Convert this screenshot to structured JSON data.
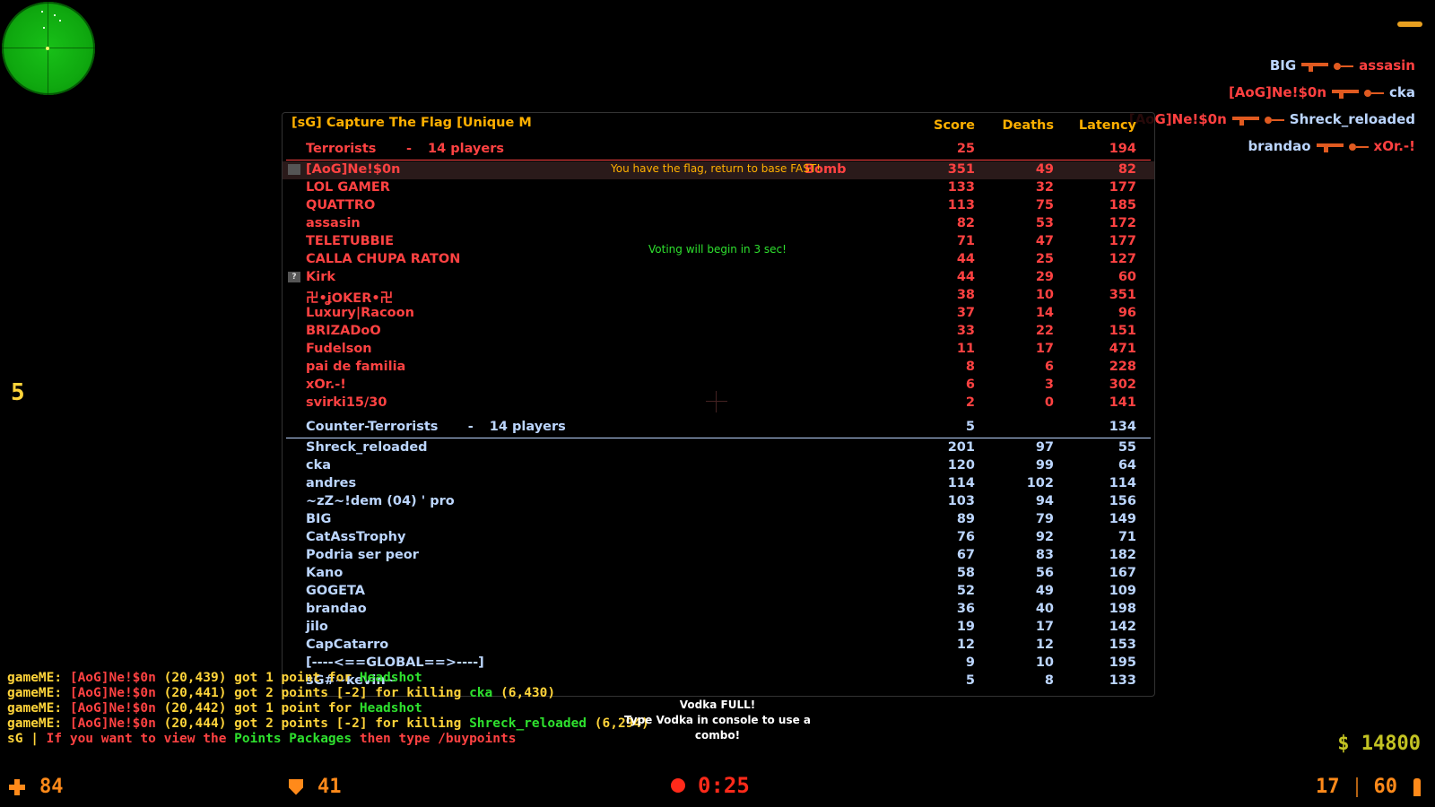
{
  "killfeed": [
    {
      "killer": "BIG",
      "killer_team": "ct",
      "victim": "assasin",
      "victim_team": "t"
    },
    {
      "killer": "[AoG]Ne!$0n",
      "killer_team": "t",
      "victim": "cka",
      "victim_team": "ct"
    },
    {
      "killer": "[AoG]Ne!$0n",
      "killer_team": "t",
      "victim": "Shreck_reloaded",
      "victim_team": "ct"
    },
    {
      "killer": "brandao",
      "killer_team": "ct",
      "victim": "xOr.-!",
      "victim_team": "t"
    }
  ],
  "scoreboard": {
    "title": "[sG] Capture The Flag [Unique M",
    "columns": {
      "score": "Score",
      "deaths": "Deaths",
      "latency": "Latency"
    },
    "terrorists": {
      "name": "Terrorists",
      "dash": "-",
      "count_label": "14 players",
      "score": "25",
      "latency": "194",
      "color": "#ff4242",
      "players": [
        {
          "name": "[AoG]Ne!$0n",
          "score": "351",
          "deaths": "49",
          "latency": "82",
          "tag": "Bomb",
          "icon": "flag-carrier-icon"
        },
        {
          "name": "LOL GAMER",
          "score": "133",
          "deaths": "32",
          "latency": "177"
        },
        {
          "name": "QUATTRO",
          "score": "113",
          "deaths": "75",
          "latency": "185"
        },
        {
          "name": "assasin",
          "score": "82",
          "deaths": "53",
          "latency": "172"
        },
        {
          "name": "TELETUBBIE",
          "score": "71",
          "deaths": "47",
          "latency": "177"
        },
        {
          "name": "CALLA CHUPA RATON",
          "score": "44",
          "deaths": "25",
          "latency": "127"
        },
        {
          "name": "Kirk",
          "score": "44",
          "deaths": "29",
          "latency": "60",
          "icon": "unknown-icon"
        },
        {
          "name": "卍•ʝOKER•卍",
          "score": "38",
          "deaths": "10",
          "latency": "351"
        },
        {
          "name": "Luxury|Racoon",
          "score": "37",
          "deaths": "14",
          "latency": "96"
        },
        {
          "name": "BRIZADoO",
          "score": "33",
          "deaths": "22",
          "latency": "151"
        },
        {
          "name": "Fudelson",
          "score": "11",
          "deaths": "17",
          "latency": "471"
        },
        {
          "name": "pai de familia",
          "score": "8",
          "deaths": "6",
          "latency": "228"
        },
        {
          "name": "xOr.-!",
          "score": "6",
          "deaths": "3",
          "latency": "302"
        },
        {
          "name": "svirki15/30",
          "score": "2",
          "deaths": "0",
          "latency": "141"
        }
      ]
    },
    "counter_terrorists": {
      "name": "Counter-Terrorists",
      "dash": "-",
      "count_label": "14 players",
      "score": "5",
      "latency": "134",
      "color": "#bcd6ff",
      "players": [
        {
          "name": "Shreck_reloaded",
          "score": "201",
          "deaths": "97",
          "latency": "55"
        },
        {
          "name": "cka",
          "score": "120",
          "deaths": "99",
          "latency": "64"
        },
        {
          "name": "andres",
          "score": "114",
          "deaths": "102",
          "latency": "114"
        },
        {
          "name": "~zZ~!dem (04) ' pro",
          "score": "103",
          "deaths": "94",
          "latency": "156"
        },
        {
          "name": "BIG",
          "score": "89",
          "deaths": "79",
          "latency": "149"
        },
        {
          "name": "CatAssTrophy",
          "score": "76",
          "deaths": "92",
          "latency": "71"
        },
        {
          "name": "Podria ser peor",
          "score": "67",
          "deaths": "83",
          "latency": "182"
        },
        {
          "name": "Kano",
          "score": "58",
          "deaths": "56",
          "latency": "167"
        },
        {
          "name": "GOGETA",
          "score": "52",
          "deaths": "49",
          "latency": "109"
        },
        {
          "name": "brandao",
          "score": "36",
          "deaths": "40",
          "latency": "198"
        },
        {
          "name": "jilo",
          "score": "19",
          "deaths": "17",
          "latency": "142"
        },
        {
          "name": "CapCatarro",
          "score": "12",
          "deaths": "12",
          "latency": "153"
        },
        {
          "name": "[----<==GLOBAL==>----]",
          "score": "9",
          "deaths": "10",
          "latency": "195"
        },
        {
          "name": "sG#~kevin~",
          "score": "5",
          "deaths": "8",
          "latency": "133"
        }
      ]
    }
  },
  "center": {
    "flag_msg": "You have the flag, return to base FAST!",
    "vote_msg": "Voting will begin in 3 sec!"
  },
  "left_number": "5",
  "chat": [
    [
      {
        "t": "gameME: ",
        "c": "y"
      },
      {
        "t": "[AoG]Ne!$0n",
        "c": "r"
      },
      {
        "t": " (20,439) got 1 point for ",
        "c": "y"
      },
      {
        "t": "Headshot",
        "c": "g"
      }
    ],
    [
      {
        "t": "gameME: ",
        "c": "y"
      },
      {
        "t": "[AoG]Ne!$0n",
        "c": "r"
      },
      {
        "t": " (20,441) got 2 points [-2] for killing ",
        "c": "y"
      },
      {
        "t": "cka",
        "c": "g"
      },
      {
        "t": " (6,430)",
        "c": "y"
      }
    ],
    [
      {
        "t": "gameME: ",
        "c": "y"
      },
      {
        "t": "[AoG]Ne!$0n",
        "c": "r"
      },
      {
        "t": " (20,442) got 1 point for ",
        "c": "y"
      },
      {
        "t": "Headshot",
        "c": "g"
      }
    ],
    [
      {
        "t": "gameME: ",
        "c": "y"
      },
      {
        "t": "[AoG]Ne!$0n",
        "c": "r"
      },
      {
        "t": " (20,444) got 2 points [-2] for killing ",
        "c": "y"
      },
      {
        "t": "Shreck_reloaded",
        "c": "g"
      },
      {
        "t": " (6,294)",
        "c": "y"
      }
    ],
    [
      {
        "t": "sG | ",
        "c": "y"
      },
      {
        "t": "If you want to view the ",
        "c": "r"
      },
      {
        "t": "Points Packages",
        "c": "g"
      },
      {
        "t": " then type ",
        "c": "r"
      },
      {
        "t": "/buypoints",
        "c": "r"
      }
    ]
  ],
  "vodka": {
    "line1": "Vodka FULL!",
    "line2": "Type Vodka in console to use a combo!"
  },
  "hud": {
    "health": "84",
    "armor": "41",
    "timer": "0:25",
    "money": "$ 14800",
    "clip": "17",
    "reserve": "60"
  }
}
